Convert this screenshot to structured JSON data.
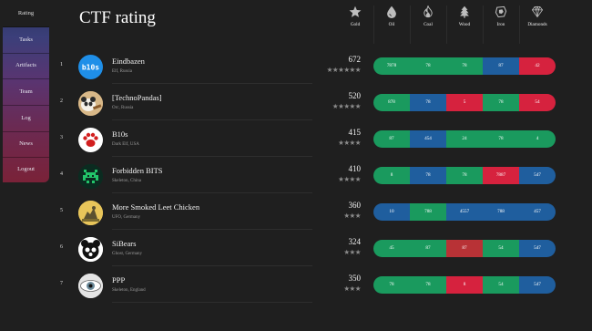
{
  "page": {
    "title": "CTF rating"
  },
  "nav": [
    {
      "label": "Rating",
      "active": true
    },
    {
      "label": "Tasks",
      "active": false
    },
    {
      "label": "Artifacts",
      "active": false
    },
    {
      "label": "Team",
      "active": false
    },
    {
      "label": "Log",
      "active": false
    },
    {
      "label": "News",
      "active": false
    },
    {
      "label": "Logout",
      "active": false
    }
  ],
  "columns": [
    {
      "label": "Gold",
      "icon": "star-icon"
    },
    {
      "label": "Oil",
      "icon": "oil-drop-icon"
    },
    {
      "label": "Coal",
      "icon": "flame-icon"
    },
    {
      "label": "Wood",
      "icon": "tree-icon"
    },
    {
      "label": "Iron",
      "icon": "iron-icon"
    },
    {
      "label": "Diamonds",
      "icon": "diamond-icon"
    }
  ],
  "colors": {
    "green": "#1a9a5e",
    "blue": "#1f5e9e",
    "red": "#d6223e",
    "darkred": "#b83236"
  },
  "teams": [
    {
      "rank": "1",
      "name": "Eindbazen",
      "sub": "Elf, Russia",
      "score": "672",
      "stars": "★★★★★★",
      "avatar": "b10s-logo",
      "resources": [
        {
          "v": "7878",
          "c": "green"
        },
        {
          "v": "78",
          "c": "green"
        },
        {
          "v": "78",
          "c": "green"
        },
        {
          "v": "87",
          "c": "blue"
        },
        {
          "v": "42",
          "c": "red"
        }
      ]
    },
    {
      "rank": "2",
      "name": "[TechnoPandas]",
      "sub": "Orc, Russia",
      "score": "520",
      "stars": "★★★★★",
      "avatar": "panda-avatar",
      "resources": [
        {
          "v": "878",
          "c": "green"
        },
        {
          "v": "78",
          "c": "blue"
        },
        {
          "v": "5",
          "c": "red"
        },
        {
          "v": "78",
          "c": "green"
        },
        {
          "v": "54",
          "c": "red"
        }
      ]
    },
    {
      "rank": "3",
      "name": "B10s",
      "sub": "Dark Elf, USA",
      "score": "415",
      "stars": "★★★★",
      "avatar": "paw-avatar",
      "resources": [
        {
          "v": "87",
          "c": "green"
        },
        {
          "v": "454",
          "c": "blue"
        },
        {
          "v": "24",
          "c": "green"
        },
        {
          "v": "78",
          "c": "green"
        },
        {
          "v": "4",
          "c": "green"
        }
      ]
    },
    {
      "rank": "4",
      "name": "Forbidden BITS",
      "sub": "Skeleton, China",
      "score": "410",
      "stars": "★★★★",
      "avatar": "invader-avatar",
      "resources": [
        {
          "v": "8",
          "c": "green"
        },
        {
          "v": "78",
          "c": "blue"
        },
        {
          "v": "78",
          "c": "green"
        },
        {
          "v": "7887",
          "c": "red"
        },
        {
          "v": "547",
          "c": "blue"
        }
      ]
    },
    {
      "rank": "5",
      "name": "More Smoked Leet Chicken",
      "sub": "UFO, Germany",
      "score": "360",
      "stars": "★★★",
      "avatar": "chicken-avatar",
      "resources": [
        {
          "v": "10",
          "c": "blue"
        },
        {
          "v": "788",
          "c": "green"
        },
        {
          "v": "4557",
          "c": "blue"
        },
        {
          "v": "788",
          "c": "blue"
        },
        {
          "v": "457",
          "c": "blue"
        }
      ]
    },
    {
      "rank": "6",
      "name": "SiBears",
      "sub": "Ghost, Germany",
      "score": "324",
      "stars": "★★★",
      "avatar": "bear-avatar",
      "resources": [
        {
          "v": "45",
          "c": "green"
        },
        {
          "v": "87",
          "c": "green"
        },
        {
          "v": "87",
          "c": "darkred"
        },
        {
          "v": "54",
          "c": "green"
        },
        {
          "v": "547",
          "c": "blue"
        }
      ]
    },
    {
      "rank": "7",
      "name": "PPP",
      "sub": "Skeleton, England",
      "score": "350",
      "stars": "★★★",
      "avatar": "eye-avatar",
      "resources": [
        {
          "v": "78",
          "c": "green"
        },
        {
          "v": "78",
          "c": "green"
        },
        {
          "v": "8",
          "c": "red"
        },
        {
          "v": "54",
          "c": "green"
        },
        {
          "v": "547",
          "c": "blue"
        }
      ]
    }
  ]
}
